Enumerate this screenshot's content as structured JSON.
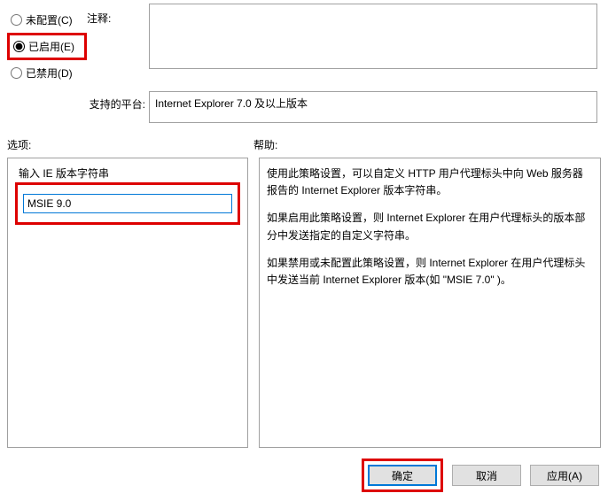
{
  "radios": {
    "not_configured": "未配置(C)",
    "enabled": "已启用(E)",
    "disabled": "已禁用(D)",
    "selected": "enabled"
  },
  "comment": {
    "label": "注释:",
    "value": ""
  },
  "platform": {
    "label": "支持的平台:",
    "value": "Internet Explorer 7.0 及以上版本"
  },
  "options": {
    "heading": "选项:",
    "field_label": "输入 IE 版本字符串",
    "field_value": "MSIE 9.0"
  },
  "help": {
    "heading": "帮助:",
    "p1": "使用此策略设置，可以自定义 HTTP 用户代理标头中向 Web 服务器报告的 Internet Explorer 版本字符串。",
    "p2": "如果启用此策略设置，则 Internet Explorer 在用户代理标头的版本部分中发送指定的自定义字符串。",
    "p3": "如果禁用或未配置此策略设置，则 Internet Explorer 在用户代理标头中发送当前 Internet Explorer 版本(如 \"MSIE 7.0\" )。"
  },
  "buttons": {
    "ok": "确定",
    "cancel": "取消",
    "apply": "应用(A)"
  }
}
